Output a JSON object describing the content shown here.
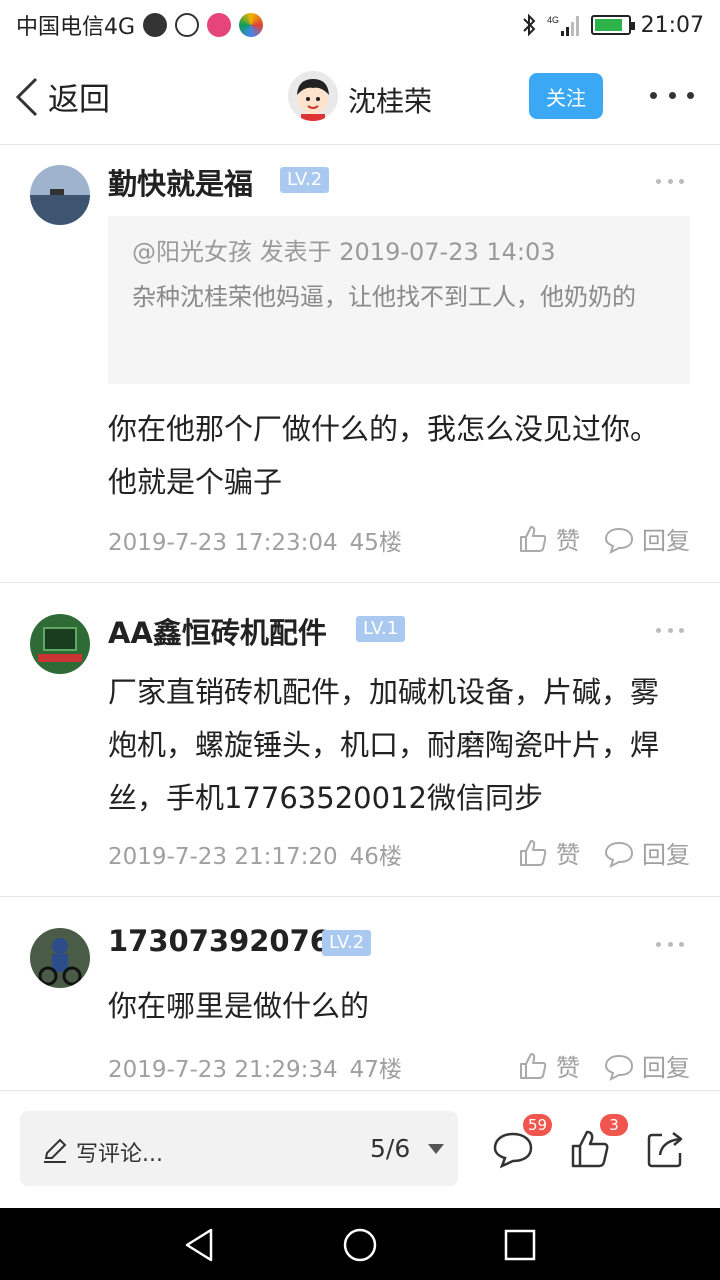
{
  "status_bar": {
    "carrier": "中国电信4G",
    "time": "21:07",
    "network": "4G",
    "battery_color": "#2db34a"
  },
  "header": {
    "back_label": "返回",
    "author_name": "沈桂荣",
    "follow_label": "关注",
    "accent_color": "#3aa8f5"
  },
  "comments": [
    {
      "username": "勤快就是福",
      "level": "LV.2",
      "quote": {
        "head": "@阳光女孩 发表于 2019-07-23 14:03",
        "text": "杂种沈桂荣他妈逼，让他找不到工人，他奶奶的"
      },
      "text": "你在他那个厂做什么的，我怎么没见过你。他就是个骗子",
      "time": "2019-7-23 17:23:04",
      "floor": "45楼",
      "like_label": "赞",
      "reply_label": "回复"
    },
    {
      "username": "AA鑫恒砖机配件",
      "level": "LV.1",
      "text": "厂家直销砖机配件，加碱机设备，片碱，雾炮机，螺旋锤头，机口，耐磨陶瓷叶片，焊丝，手机17763520012微信同步",
      "time": "2019-7-23 21:17:20",
      "floor": "46楼",
      "like_label": "赞",
      "reply_label": "回复"
    },
    {
      "username": "17307392076",
      "level": "LV.2",
      "text": "你在哪里是做什么的",
      "time": "2019-7-23 21:29:34",
      "floor": "47楼",
      "like_label": "赞",
      "reply_label": "回复"
    }
  ],
  "bottom_bar": {
    "write_placeholder": "写评论...",
    "page_indicator": "5/6",
    "comment_count": "59",
    "like_count": "3",
    "badge_color": "#f0564d"
  }
}
